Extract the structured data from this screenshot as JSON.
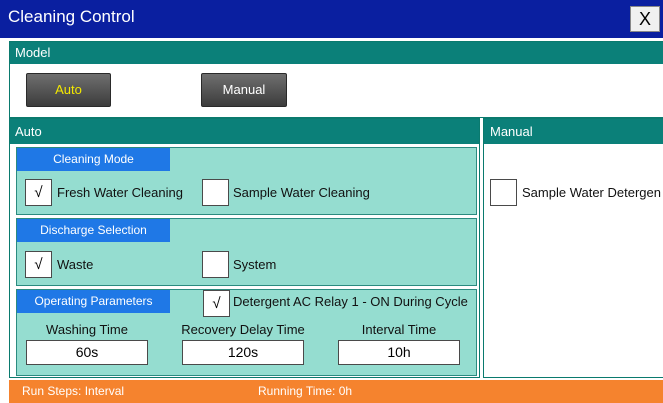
{
  "window": {
    "title": "Cleaning Control",
    "close_label": "X"
  },
  "model": {
    "title": "Model",
    "auto_label": "Auto",
    "manual_label": "Manual"
  },
  "auto": {
    "title": "Auto",
    "cleaning_mode": {
      "label": "Cleaning Mode",
      "options": [
        {
          "label": "Fresh Water Cleaning",
          "mark": "√"
        },
        {
          "label": "Sample Water Cleaning",
          "mark": ""
        }
      ]
    },
    "discharge": {
      "label": "Discharge Selection",
      "options": [
        {
          "label": "Waste",
          "mark": "√"
        },
        {
          "label": "System",
          "mark": ""
        }
      ]
    },
    "params": {
      "label": "Operating Parameters",
      "detergent": {
        "label": "Detergent AC Relay 1 - ON During Cycle",
        "mark": "√"
      },
      "washing_time": {
        "label": "Washing Time",
        "value": "60s"
      },
      "recovery_delay": {
        "label": "Recovery Delay Time",
        "value": "120s"
      },
      "interval": {
        "label": "Interval Time",
        "value": "10h"
      }
    }
  },
  "manual": {
    "title": "Manual",
    "detergent": {
      "label": "Sample Water Detergen",
      "mark": ""
    }
  },
  "status": {
    "run_steps": "Run Steps: Interval",
    "running_time": "Running Time: 0h"
  },
  "colors": {
    "title_bar": "#0a1fa0",
    "teal_header": "#0b8079",
    "section_bg": "#95ddd0",
    "label_blue": "#1f78e6",
    "status_orange": "#f5832e",
    "auto_text": "#f3e800"
  }
}
